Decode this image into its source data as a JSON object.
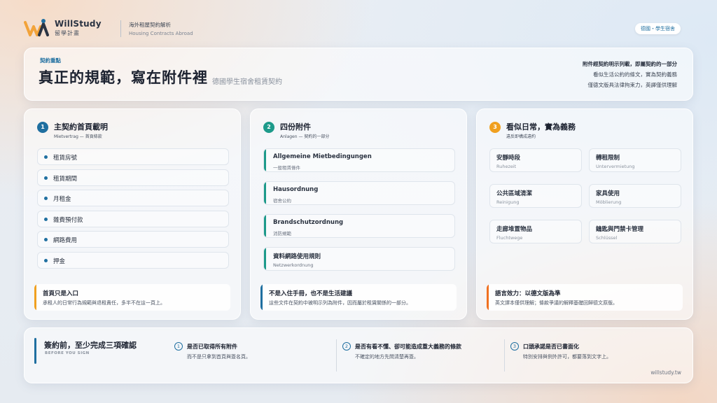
{
  "header": {
    "brand_name": "WillStudy",
    "brand_sub": "留學計畫",
    "line1": "海外租屋契約解析",
    "line2": "Housing Contracts Abroad",
    "tag": "德國・學生宿舍"
  },
  "banner": {
    "kicker": "契約重點",
    "title": "真正的規範，寫在附件裡",
    "subtitle": "德國學生宿舍租賃契約",
    "notes": [
      "附件經契約明示列載，即屬契約的一部分",
      "看似生活公約的條文，實為契約義務",
      "僅德文版具法律拘束力，英譯僅供理解"
    ]
  },
  "cards": [
    {
      "num": "1",
      "title": "主契約首頁載明",
      "sub": "Mietvertrag — 首頁條款",
      "items": [
        "租賃房號",
        "租賃期間",
        "月租金",
        "雜費預付款",
        "網路費用",
        "押金"
      ],
      "foot_title": "首頁只是入口",
      "foot_text": "承租人的日常行為規範與退租責任，多半不在這一頁上。"
    },
    {
      "num": "2",
      "title": "四份附件",
      "sub": "Anlagen — 契約的一部分",
      "items": [
        {
          "de": "Allgemeine Mietbedingungen",
          "zh": "一般租賃條件"
        },
        {
          "de": "Hausordnung",
          "zh": "宿舍公約"
        },
        {
          "de": "Brandschutzordnung",
          "zh": "消防規範"
        },
        {
          "de": "資料網路使用規則",
          "zh": "Netzwerkordnung"
        }
      ],
      "foot_title": "不是入住手冊，也不是生活建議",
      "foot_text": "這些文件在契約中被明示列為附件，因而屬於租賃關係的一部分。"
    },
    {
      "num": "3",
      "title": "看似日常，實為義務",
      "sub": "違反即構成違約",
      "items": [
        {
          "zh": "安靜時段",
          "de": "Ruhezeit"
        },
        {
          "zh": "轉租限制",
          "de": "Untervermietung"
        },
        {
          "zh": "公共區域清潔",
          "de": "Reinigung"
        },
        {
          "zh": "家具使用",
          "de": "Möblierung"
        },
        {
          "zh": "走廊堆置物品",
          "de": "Fluchtwege"
        },
        {
          "zh": "鑰匙與門禁卡管理",
          "de": "Schlüssel"
        }
      ],
      "foot_title": "語言效力：以德文版為準",
      "foot_text": "英文譯本僅供理解；條款爭議的解釋基礎回歸德文原版。"
    }
  ],
  "bottom": {
    "title": "簽約前，至少完成三項確認",
    "sub": "BEFORE YOU SIGN",
    "checks": [
      {
        "num": "1",
        "title": "是否已取得所有附件",
        "text": "而不是只拿到首頁與簽名頁。"
      },
      {
        "num": "2",
        "title": "是否有看不懂、卻可能造成重大義務的條款",
        "text": "不確定的地方先問清楚再簽。"
      },
      {
        "num": "3",
        "title": "口頭承諾是否已書面化",
        "text": "特別安排與例外許可，都要落到文字上。"
      }
    ],
    "site": "willstudy.tw"
  },
  "colors": {
    "blue": "#1f6fa0",
    "teal": "#1d9a8a",
    "orange": "#f0a020",
    "logo_orange": "#f2a33a"
  },
  "icons": [
    "willstudy-logo"
  ]
}
